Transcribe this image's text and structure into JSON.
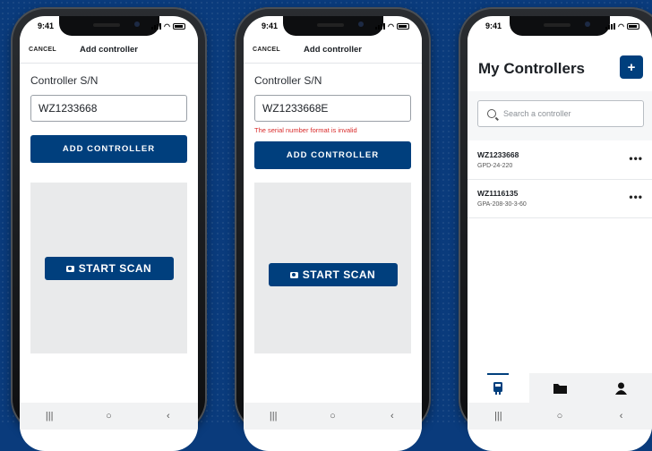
{
  "status": {
    "time": "9:41"
  },
  "phone1": {
    "nav": {
      "cancel": "CANCEL",
      "title": "Add controller"
    },
    "label": "Controller S/N",
    "input_value": "WZ1233668",
    "add_button": "ADD CONTROLLER",
    "scan_button": "START SCAN"
  },
  "phone2": {
    "nav": {
      "cancel": "CANCEL",
      "title": "Add controller"
    },
    "label": "Controller S/N",
    "input_value": "WZ1233668E",
    "error": "The serial number format is invalid",
    "add_button": "ADD CONTROLLER",
    "scan_button": "START SCAN"
  },
  "phone3": {
    "title": "My Controllers",
    "add_icon": "+",
    "search_placeholder": "Search a controller",
    "controllers": [
      {
        "serial": "WZ1233668",
        "model": "GPD-24-220"
      },
      {
        "serial": "WZ1116135",
        "model": "GPA-208-30-3-60"
      }
    ],
    "more_icon": "•••",
    "tabs": [
      "controller-icon",
      "folder-icon",
      "user-icon"
    ]
  },
  "sysnav": {
    "recents": "|||",
    "home": "○",
    "back": "‹"
  },
  "colors": {
    "primary": "#003f7d",
    "error": "#d92b2b",
    "background": "#0a3b7c"
  }
}
